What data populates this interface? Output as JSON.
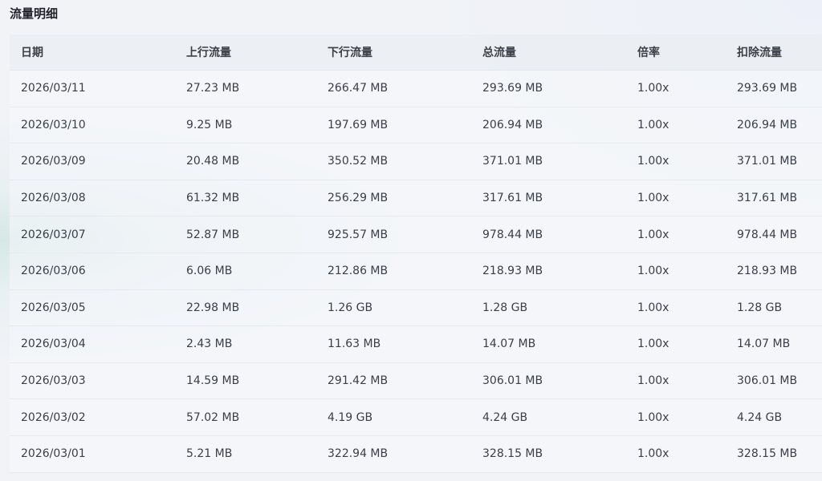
{
  "section": {
    "title": "流量明细"
  },
  "table": {
    "columns": [
      "日期",
      "上行流量",
      "下行流量",
      "总流量",
      "倍率",
      "扣除流量"
    ],
    "rows": [
      [
        "2026/03/11",
        "27.23 MB",
        "266.47 MB",
        "293.69 MB",
        "1.00x",
        "293.69 MB"
      ],
      [
        "2026/03/10",
        "9.25 MB",
        "197.69 MB",
        "206.94 MB",
        "1.00x",
        "206.94 MB"
      ],
      [
        "2026/03/09",
        "20.48 MB",
        "350.52 MB",
        "371.01 MB",
        "1.00x",
        "371.01 MB"
      ],
      [
        "2026/03/08",
        "61.32 MB",
        "256.29 MB",
        "317.61 MB",
        "1.00x",
        "317.61 MB"
      ],
      [
        "2026/03/07",
        "52.87 MB",
        "925.57 MB",
        "978.44 MB",
        "1.00x",
        "978.44 MB"
      ],
      [
        "2026/03/06",
        "6.06 MB",
        "212.86 MB",
        "218.93 MB",
        "1.00x",
        "218.93 MB"
      ],
      [
        "2026/03/05",
        "22.98 MB",
        "1.26 GB",
        "1.28 GB",
        "1.00x",
        "1.28 GB"
      ],
      [
        "2026/03/04",
        "2.43 MB",
        "11.63 MB",
        "14.07 MB",
        "1.00x",
        "14.07 MB"
      ],
      [
        "2026/03/03",
        "14.59 MB",
        "291.42 MB",
        "306.01 MB",
        "1.00x",
        "306.01 MB"
      ],
      [
        "2026/03/02",
        "57.02 MB",
        "4.19 GB",
        "4.24 GB",
        "1.00x",
        "4.24 GB"
      ],
      [
        "2026/03/01",
        "5.21 MB",
        "322.94 MB",
        "328.15 MB",
        "1.00x",
        "328.15 MB"
      ]
    ]
  }
}
